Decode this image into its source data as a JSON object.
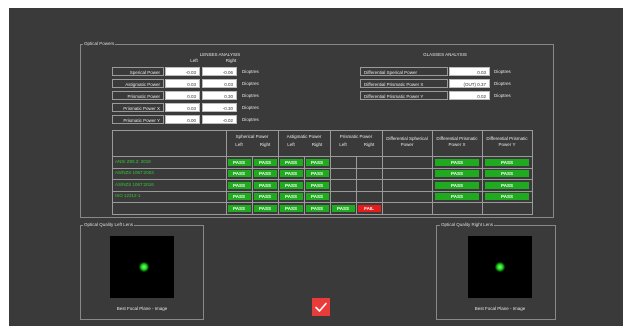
{
  "optical_powers": {
    "title": "Optical Powers",
    "lenses": {
      "title": "LENSES ANALYSIS",
      "col_left": "Left",
      "col_right": "Right",
      "rows": [
        {
          "label": "Sperical Power",
          "left": "-0.03",
          "right": "-0.06",
          "unit": "Dioptres"
        },
        {
          "label": "Astigmatic Power",
          "left": "0.03",
          "right": "0.03",
          "unit": "Dioptres"
        },
        {
          "label": "Prismatic Power",
          "left": "0.03",
          "right": "0.30",
          "unit": "Dioptres"
        },
        {
          "label": "Prismatic Power X",
          "left": "0.03",
          "right": "-0.30",
          "unit": "Dioptres"
        },
        {
          "label": "Prismatic Power Y",
          "left": "0.00",
          "right": "-0.02",
          "unit": "Dioptres"
        }
      ]
    },
    "glasses": {
      "title": "GLASSES ANALYSIS",
      "rows": [
        {
          "label": "Differential Sperical Power",
          "value": "0.03",
          "unit": "Dioptres"
        },
        {
          "label": "Differential Prismatic Power X",
          "value": "(OUT) 0.37",
          "unit": "Dioptres"
        },
        {
          "label": "Differential Prismatic Power Y",
          "value": "0.02",
          "unit": "Dioptres"
        }
      ]
    }
  },
  "standards_table": {
    "headers": [
      {
        "title": "Spherical Power",
        "left": "Left",
        "right": "Right"
      },
      {
        "title": "Astigmatic Power",
        "left": "Left",
        "right": "Right"
      },
      {
        "title": "Prismatic Power",
        "left": "Left",
        "right": "Right"
      },
      {
        "title": "Differential Spherical Power",
        "left": "",
        "right": ""
      },
      {
        "title": "Differential Prismatic Power X",
        "left": "",
        "right": ""
      },
      {
        "title": "Differential Prismatic Power Y",
        "left": "",
        "right": ""
      }
    ],
    "rows": [
      {
        "name": "ANSI Z80.3: 2018",
        "color": "#35c635",
        "cells": [
          "PASS",
          "PASS",
          "PASS",
          "PASS",
          "",
          "",
          "",
          "PASS",
          "PASS"
        ]
      },
      {
        "name": "AS/NZS 1067:2003",
        "color": "#35c635",
        "cells": [
          "PASS",
          "PASS",
          "PASS",
          "PASS",
          "",
          "",
          "",
          "PASS",
          "PASS"
        ]
      },
      {
        "name": "AS/NZS 1067:2016",
        "color": "#35c635",
        "cells": [
          "PASS",
          "PASS",
          "PASS",
          "PASS",
          "",
          "",
          "",
          "PASS",
          "PASS"
        ]
      },
      {
        "name": "ISO 12312-1",
        "color": "#35c635",
        "cells": [
          "PASS",
          "PASS",
          "PASS",
          "PASS",
          "",
          "",
          "",
          "PASS",
          "PASS"
        ]
      },
      {
        "name": "",
        "color": "#e31c1c",
        "cells": [
          "PASS",
          "PASS",
          "PASS",
          "PASS",
          "PASS",
          "FAIL",
          "",
          "",
          ""
        ]
      }
    ]
  },
  "quality_left": {
    "title": "Optical Quality Left Lens",
    "caption": "Best Focal Plane - Image"
  },
  "quality_right": {
    "title": "Optical Quality Right Lens",
    "caption": "Best Focal Plane - Image"
  },
  "colors": {
    "pass": "#1faa1f",
    "fail": "#e31c1c",
    "background": "#3a3a3a"
  }
}
